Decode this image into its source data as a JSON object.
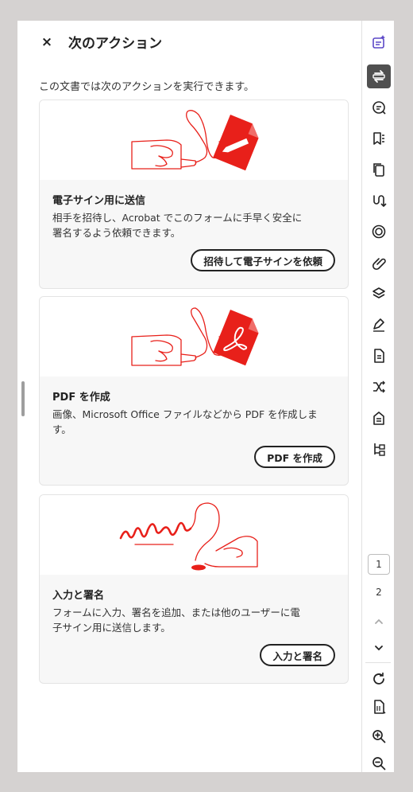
{
  "header": {
    "close_label": "×",
    "title": "次のアクション"
  },
  "intro_text": "この文書では次のアクションを実行できます。",
  "cards": [
    {
      "title": "電子サイン用に送信",
      "description_line1": "相手を招待し、Acrobat でこのフォームに手早く安全に",
      "description_line2": "署名するよう依頼できます。",
      "button_label": "招待して電子サインを依頼",
      "illustration": "hand-with-signing-pen-illustration"
    },
    {
      "title": "PDF を作成",
      "description_line1": "画像、Microsoft Office ファイルなどから PDF を作成しま",
      "description_line2": "す。",
      "button_label": "PDF を作成",
      "illustration": "hand-with-acrobat-file-illustration"
    },
    {
      "title": "入力と署名",
      "description_line1": "フォームに入力、署名を追加、または他のユーザーに電",
      "description_line2": "子サイン用に送信します。",
      "button_label": "入力と署名",
      "illustration": "hand-writing-signature-illustration"
    }
  ],
  "rail": {
    "icons": [
      "ai-assistant-icon",
      "next-actions-icon",
      "comments-icon",
      "bookmarks-icon",
      "page-thumbnails-icon",
      "attachments-connector-icon",
      "layers-target-icon",
      "link-icon",
      "stack-layers-icon",
      "fill-sign-pen-icon",
      "document-icon",
      "compare-arrows-icon",
      "accessibility-tag-icon",
      "content-tree-icon"
    ],
    "current_page": "1",
    "next_page": "2",
    "bottom_icons": [
      "chevron-up-icon",
      "chevron-down-icon",
      "rotate-icon",
      "fit-page-icon",
      "zoom-in-icon",
      "zoom-out-icon"
    ]
  },
  "colors": {
    "accent_red": "#e8201a",
    "active_rail": "#505050",
    "ai_purple": "#5c48c7"
  }
}
